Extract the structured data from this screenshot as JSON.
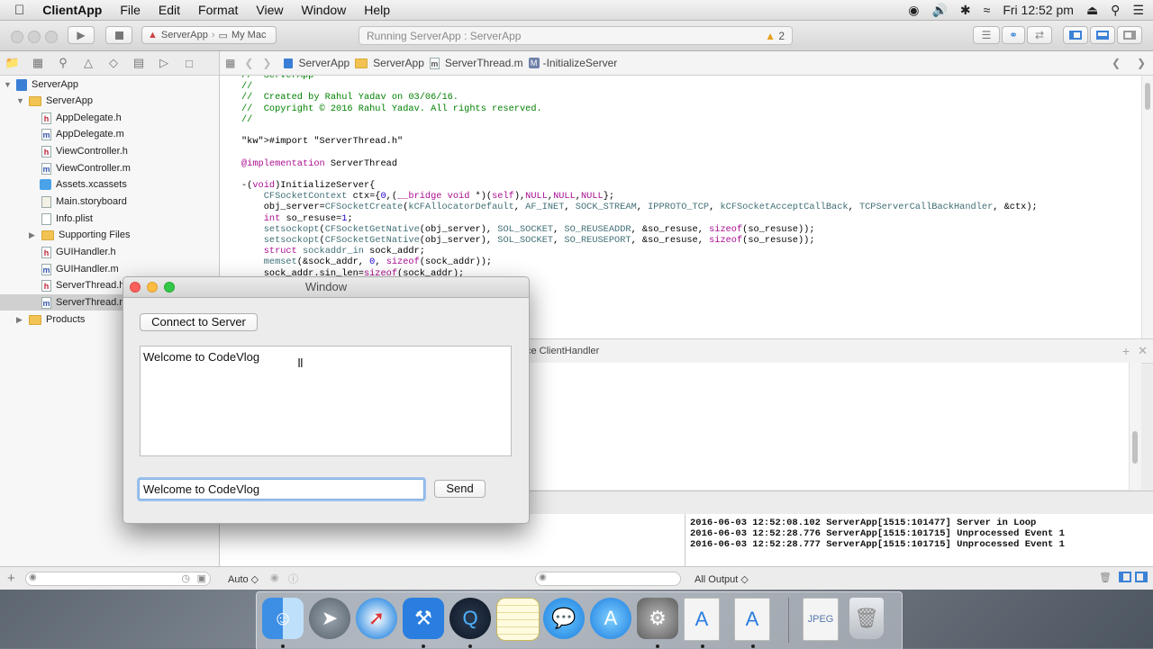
{
  "menubar": {
    "apple_icon": "apple-icon",
    "app_name": "ClientApp",
    "items": [
      "File",
      "Edit",
      "Format",
      "View",
      "Window",
      "Help"
    ],
    "clock": "Fri 12:52 pm"
  },
  "toolbar": {
    "scheme": "ServerApp",
    "destination": "My Mac",
    "activity_text": "Running ServerApp : ServerApp",
    "warning_count": "2",
    "accent": "#f5a623"
  },
  "jumpbar": {
    "crumbs": [
      "ServerApp",
      "ServerApp",
      "ServerThread.m",
      "-InitializeServer"
    ]
  },
  "navigator": {
    "items": [
      {
        "label": "ServerApp",
        "icon": "project-icon"
      },
      {
        "label": "ServerApp",
        "icon": "folder-icon"
      },
      {
        "label": "AppDelegate.h",
        "icon": "h"
      },
      {
        "label": "AppDelegate.m",
        "icon": "m"
      },
      {
        "label": "ViewController.h",
        "icon": "h"
      },
      {
        "label": "ViewController.m",
        "icon": "m"
      },
      {
        "label": "Assets.xcassets",
        "icon": "assets-icon"
      },
      {
        "label": "Main.storyboard",
        "icon": "storyboard-icon"
      },
      {
        "label": "Info.plist",
        "icon": "plist-icon"
      },
      {
        "label": "Supporting Files",
        "icon": "folder-icon"
      },
      {
        "label": "GUIHandler.h",
        "icon": "h"
      },
      {
        "label": "GUIHandler.m",
        "icon": "m"
      },
      {
        "label": "ServerThread.h",
        "icon": "h"
      },
      {
        "label": "ServerThread.m",
        "icon": "m"
      },
      {
        "label": "Products",
        "icon": "folder-icon"
      }
    ]
  },
  "editor": {
    "code_lines": [
      "//  ServerApp",
      "//",
      "//  Created by Rahul Yadav on 03/06/16.",
      "//  Copyright © 2016 Rahul Yadav. All rights reserved.",
      "//",
      "",
      "#import \"ServerThread.h\"",
      "",
      "@implementation ServerThread",
      "",
      "-(void)InitializeServer{",
      "    CFSocketContext ctx={0,(__bridge void *)(self),NULL,NULL,NULL};",
      "    obj_server=CFSocketCreate(kCFAllocatorDefault, AF_INET, SOCK_STREAM, IPPROTO_TCP, kCFSocketAcceptCallBack, TCPServerCallBackHandler, &ctx);",
      "    int so_resuse=1;",
      "    setsockopt(CFSocketGetNative(obj_server), SOL_SOCKET, SO_REUSEADDR, &so_resuse, sizeof(so_resuse));",
      "    setsockopt(CFSocketGetNative(obj_server), SOL_SOCKET, SO_REUSEPORT, &so_resuse, sizeof(so_resuse));",
      "    struct sockaddr_in sock_addr;",
      "    memset(&sock_addr, 0, sizeof(sock_addr));",
      "    sock_addr.sin_len=sizeof(sock_addr);"
    ],
    "assistant_label": "ce ClientHandler"
  },
  "debug": {
    "auto_label": "Auto ◇",
    "output_label": "All Output ◇",
    "console_lines": [
      "2016-06-03 12:52:08.102 ServerApp[1515:101477] Server in Loop",
      "2016-06-03 12:52:28.776 ServerApp[1515:101715] Unprocessed Event 1",
      "2016-06-03 12:52:28.777 ServerApp[1515:101715] Unprocessed Event 1"
    ]
  },
  "client_window": {
    "title": "Window",
    "connect_label": "Connect to Server",
    "message_text": "Welcome to CodeVlog",
    "input_value": "Welcome to CodeVlog",
    "send_label": "Send"
  },
  "dock": {
    "apps": [
      "finder-icon",
      "launchpad-icon",
      "safari-icon",
      "xcode-icon",
      "quicktime-icon",
      "notes-icon",
      "messages-icon",
      "appstore-icon",
      "systemprefs-icon",
      "app-document-icon",
      "app-document-icon",
      "jpeg-document-icon",
      "trash-icon"
    ]
  }
}
